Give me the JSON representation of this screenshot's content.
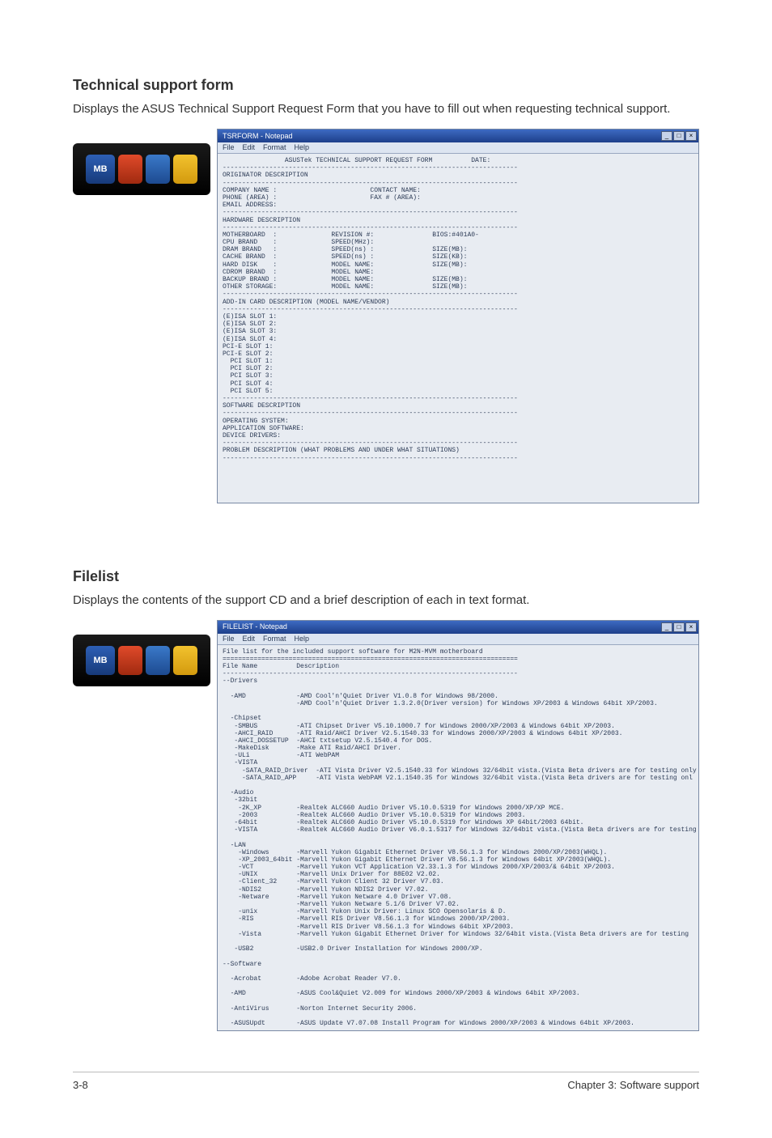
{
  "section1": {
    "title": "Technical support form",
    "desc": "Displays the ASUS Technical Support Request Form that you have to fill out when requesting technical support."
  },
  "section2": {
    "title": "Filelist",
    "desc": "Displays the contents of the support CD and a brief description of each in text format."
  },
  "logo": {
    "mb": "MB"
  },
  "notepad1": {
    "title": "TSRFORM - Notepad",
    "menu": {
      "file": "File",
      "edit": "Edit",
      "format": "Format",
      "help": "Help"
    },
    "body": "                ASUSTek TECHNICAL SUPPORT REQUEST FORM          DATE:\n----------------------------------------------------------------------------\nORIGINATOR DESCRIPTION\n----------------------------------------------------------------------------\nCOMPANY NAME :                        CONTACT NAME:\nPHONE (AREA) :                        FAX # (AREA):\nEMAIL ADDRESS:\n----------------------------------------------------------------------------\nHARDWARE DESCRIPTION\n----------------------------------------------------------------------------\nMOTHERBOARD  :              REVISION #:               BIOS:#401A0-\nCPU BRAND    :              SPEED(MHz):\nDRAM BRAND   :              SPEED(ns) :               SIZE(MB):\nCACHE BRAND  :              SPEED(ns) :               SIZE(KB):\nHARD DISK    :              MODEL NAME:               SIZE(MB):\nCDROM BRAND  :              MODEL NAME:\nBACKUP BRAND :              MODEL NAME:               SIZE(MB):\nOTHER STORAGE:              MODEL NAME:               SIZE(MB):\n----------------------------------------------------------------------------\nADD-IN CARD DESCRIPTION (MODEL NAME/VENDOR)\n----------------------------------------------------------------------------\n(E)ISA SLOT 1:\n(E)ISA SLOT 2:\n(E)ISA SLOT 3:\n(E)ISA SLOT 4:\nPCI-E SLOT 1:\nPCI-E SLOT 2:\n  PCI SLOT 1:\n  PCI SLOT 2:\n  PCI SLOT 3:\n  PCI SLOT 4:\n  PCI SLOT 5:\n----------------------------------------------------------------------------\nSOFTWARE DESCRIPTION\n----------------------------------------------------------------------------\nOPERATING SYSTEM:\nAPPLICATION SOFTWARE:\nDEVICE DRIVERS:\n----------------------------------------------------------------------------\nPROBLEM DESCRIPTION (WHAT PROBLEMS AND UNDER WHAT SITUATIONS)\n----------------------------------------------------------------------------\n\n\n\n\n\n"
  },
  "notepad2": {
    "title": "FILELIST - Notepad",
    "menu": {
      "file": "File",
      "edit": "Edit",
      "format": "Format",
      "help": "Help"
    },
    "body": "File list for the included support software for M2N-MVM motherboard\n============================================================================\nFile Name          Description\n----------------------------------------------------------------------------\n--Drivers\n\n  -AMD             -AMD Cool'n'Quiet Driver V1.0.8 for Windows 98/2000.\n                   -AMD Cool'n'Quiet Driver 1.3.2.0(Driver version) for Windows XP/2003 & Windows 64bit XP/2003.\n\n  -Chipset\n   -SMBUS          -ATI Chipset Driver V5.10.1000.7 for Windows 2000/XP/2003 & Windows 64bit XP/2003.\n   -AHCI_RAID      -ATI Raid/AHCI Driver V2.5.1540.33 for Windows 2000/XP/2003 & Windows 64bit XP/2003.\n   -AHCI_DOSSETUP  -AHCI txtsetup V2.5.1540.4 for DOS.\n   -MakeDisk       -Make ATI Raid/AHCI Driver.\n   -ULi            -ATI WebPAM\n   -VISTA\n     -SATA_RAID_Driver  -ATI Vista Driver V2.5.1540.33 for Windows 32/64bit vista.(Vista Beta drivers are for testing only\n     -SATA_RAID_APP     -ATI Vista WebPAM V2.1.1540.35 for Windows 32/64bit vista.(Vista Beta drivers are for testing onl\n\n  -Audio\n   -32bit\n    -2K_XP         -Realtek ALC660 Audio Driver V5.10.0.5319 for Windows 2000/XP/XP MCE.\n    -2003          -Realtek ALC660 Audio Driver V5.10.0.5319 for Windows 2003.\n   -64bit          -Realtek ALC660 Audio Driver V5.10.0.5319 for Windows XP 64bit/2003 64bit.\n   -VISTA          -Realtek ALC660 Audio Driver V6.0.1.5317 for Windows 32/64bit vista.(Vista Beta drivers are for testing\n\n  -LAN\n    -Windows       -Marvell Yukon Gigabit Ethernet Driver V8.56.1.3 for Windows 2000/XP/2003(WHQL).\n    -XP_2003_64bit -Marvell Yukon Gigabit Ethernet Driver V8.56.1.3 for Windows 64bit XP/2003(WHQL).\n    -VCT           -Marvell Yukon VCT Application V2.33.1.3 for Windows 2000/XP/2003/& 64bit XP/2003.\n    -UNIX          -Marvell Unix Driver for 88E02 V2.02.\n    -Client_32     -Marvell Yukon Client 32 Driver V7.03.\n    -NDIS2         -Marvell Yukon NDIS2 Driver V7.02.\n    -Netware       -Marvell Yukon Netware 4.0 Driver V7.08.\n                   -Marvell Yukon Netware 5.1/6 Driver V7.02.\n    -unix          -Marvell Yukon Unix Driver: Linux SCO Opensolaris & D.\n    -RIS           -Marvell RIS Driver V8.56.1.3 for Windows 2000/XP/2003.\n                   -Marvell RIS Driver V8.56.1.3 for Windows 64bit XP/2003.\n    -Vista         -Marvell Yukon Gigabit Ethernet Driver for Windows 32/64bit vista.(Vista Beta drivers are for testing\n\n   -USB2           -USB2.0 Driver Installation for Windows 2000/XP.\n\n--Software\n\n  -Acrobat         -Adobe Acrobat Reader V7.0.\n\n  -AMD             -ASUS Cool&Quiet V2.009 for Windows 2000/XP/2003 & Windows 64bit XP/2003.\n\n  -AntiVirus       -Norton Internet Security 2006.\n\n  -ASUSUpdt        -ASUS Update V7.07.08 Install Program for Windows 2000/XP/2003 & Windows 64bit XP/2003."
  },
  "footer": {
    "left": "3-8",
    "right": "Chapter 3: Software support"
  }
}
